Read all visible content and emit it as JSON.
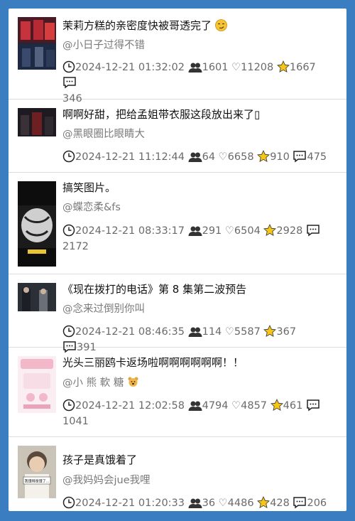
{
  "posts": [
    {
      "title": "茉莉方糕的亲密度快被哥透完了",
      "title_emoji": "smirk-emoji-icon",
      "author": "@小日子过得不错",
      "time": "2024-12-21 01:32:02",
      "views": "1601",
      "likes": "♡11208",
      "favorites": "1667",
      "comments": "346",
      "thumb_colors": [
        "#3b1d25",
        "#b12b33",
        "#2a3a5a"
      ]
    },
    {
      "title": "啊啊好甜，把给孟姐带衣服这段放出来了",
      "title_tail": "▯",
      "author": "@黑眼圈比眼睛大",
      "time": "2024-12-21 11:12:44",
      "views": "64",
      "likes": "♡6658",
      "favorites": "910",
      "comments": "475",
      "thumb_colors": [
        "#1d1a22",
        "#6d1f22",
        "#3a2c30"
      ]
    },
    {
      "title": "搞笑图片。",
      "author": "@蝶恋柔&fs",
      "time": "2024-12-21 08:33:17",
      "views": "291",
      "likes": "♡6504",
      "favorites": "2928",
      "comments": "2172",
      "thumb_colors": [
        "#0d0d0d",
        "#d8d8d8",
        "#1b1b1b"
      ]
    },
    {
      "title": "《现在拨打的电话》第 8 集第二波预告",
      "author": "@念来过倒别你叫",
      "time": "2024-12-21 08:46:35",
      "views": "114",
      "likes": "♡5587",
      "favorites": "367",
      "comments": "391",
      "thumb_colors": [
        "#2b2f36",
        "#6b6f78",
        "#1c1f26"
      ]
    },
    {
      "title": "光头三丽鸥卡返场啦啊啊啊啊啊啊！！",
      "author": "@小 熊 軟 糖",
      "author_emoji": "bear-emoji-icon",
      "time": "2024-12-21 12:02:58",
      "views": "4794",
      "likes": "♡4857",
      "favorites": "461",
      "comments": "1041",
      "thumb_colors": [
        "#f6dde6",
        "#f2b7c9",
        "#fbeef2"
      ]
    },
    {
      "title": "孩子是真饿着了",
      "author": "@我妈妈会jue我哩",
      "time": "2024-12-21 01:20:33",
      "views": "36",
      "likes": "♡4486",
      "favorites": "428",
      "comments": "206",
      "thumb_colors": [
        "#c9c3b8",
        "#f4f1ea",
        "#5a4a3b"
      ],
      "thumb_caption": "我饿得是饿了..."
    }
  ]
}
